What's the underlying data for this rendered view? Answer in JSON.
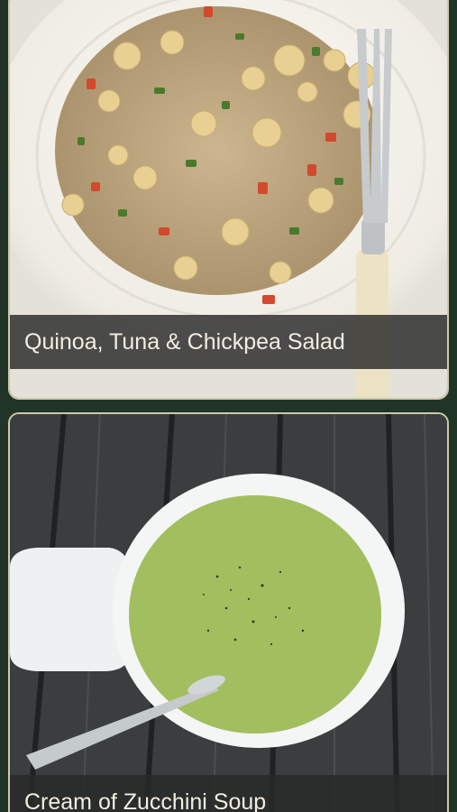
{
  "recipes": [
    {
      "title": "Quinoa, Tuna & Chickpea Salad",
      "photo_icon": "quinoa-salad-photo"
    },
    {
      "title": "Cream of Zucchini Soup",
      "photo_icon": "zucchini-soup-photo"
    }
  ],
  "colors": {
    "background": "#203528",
    "card_border": "#cfc9a8",
    "caption_bg": "#282828",
    "caption_text": "#f2ede3"
  }
}
